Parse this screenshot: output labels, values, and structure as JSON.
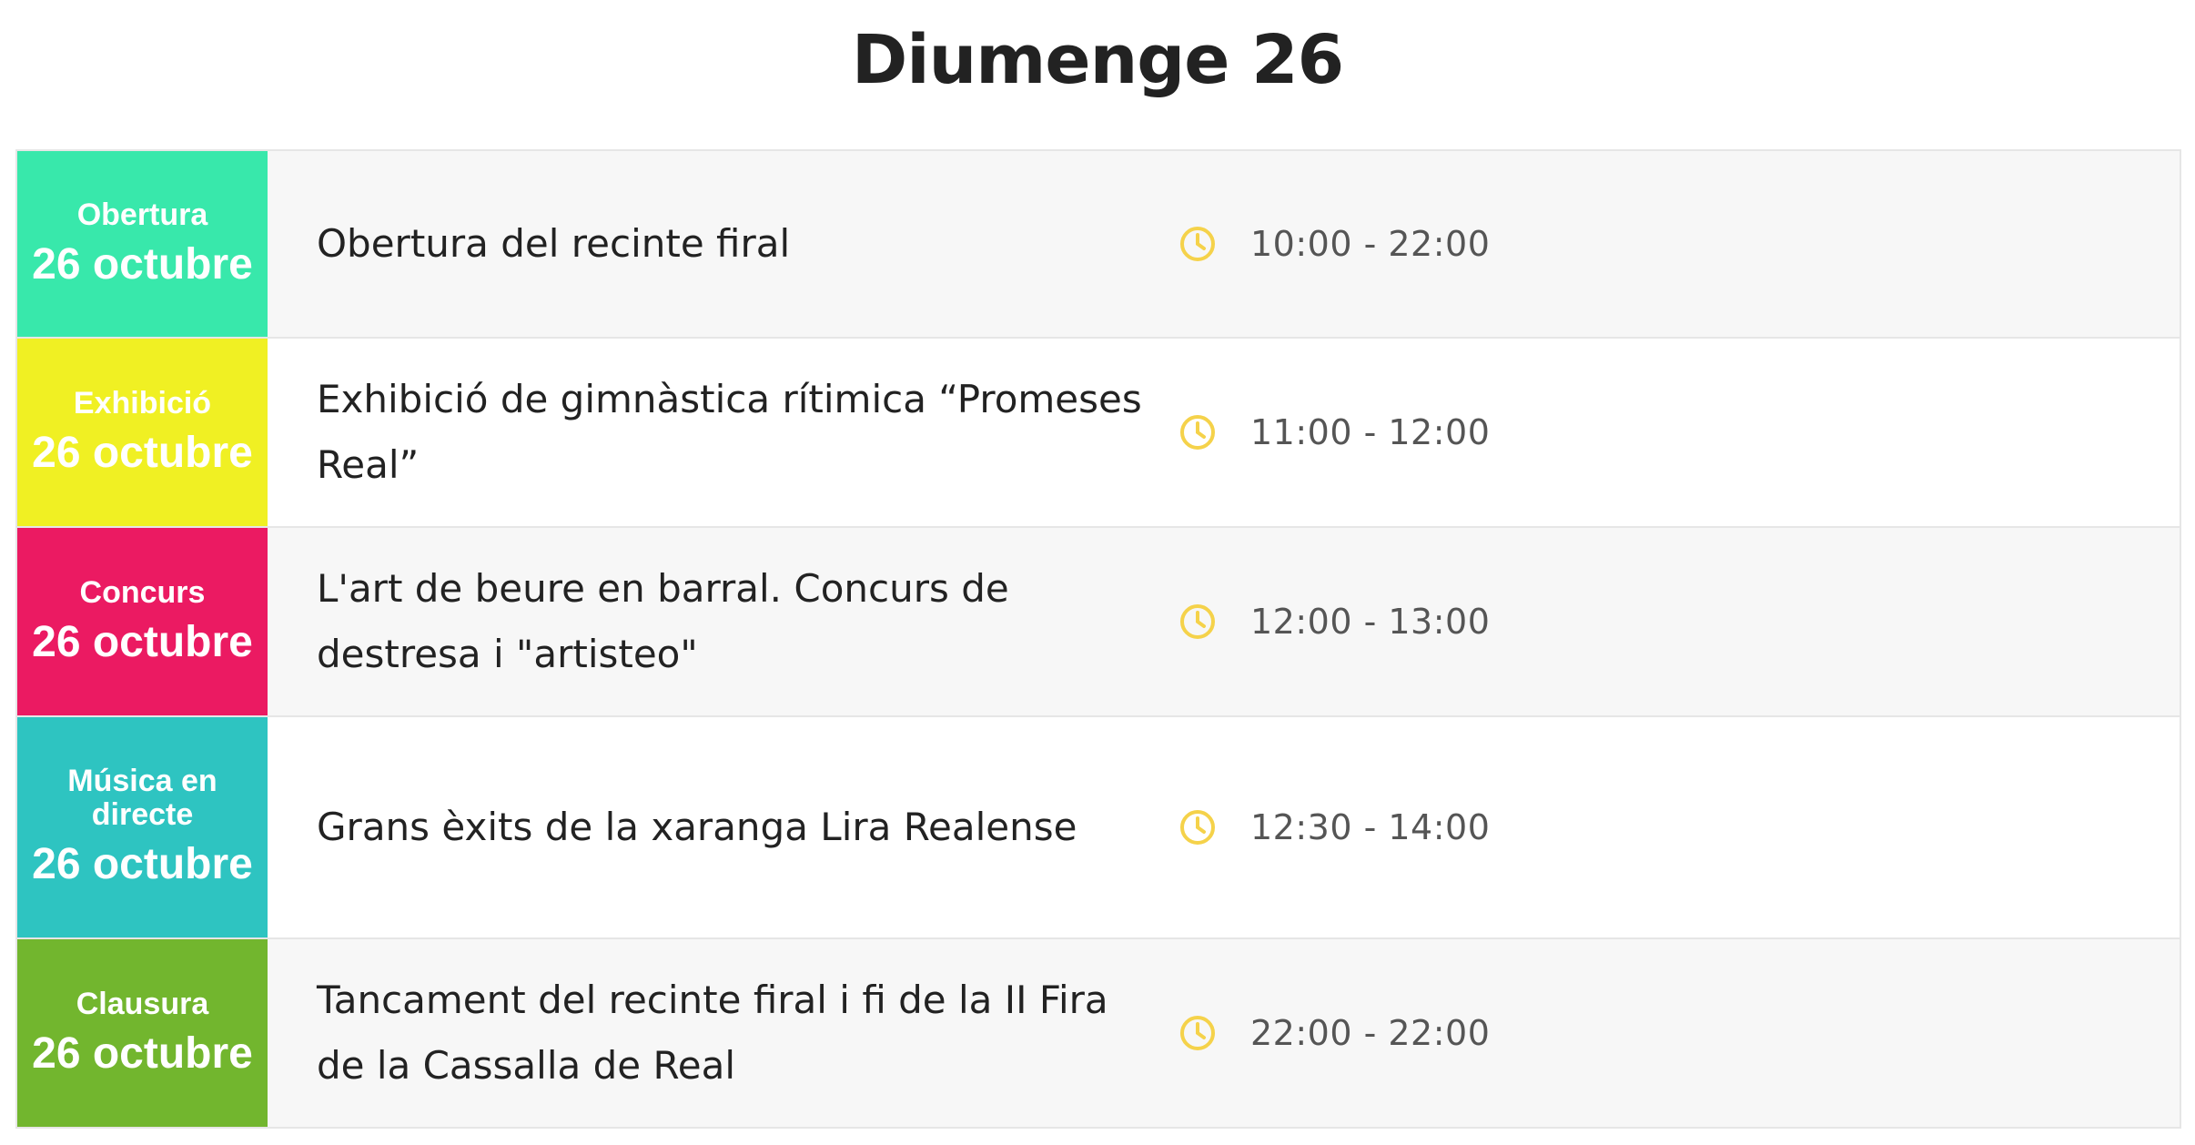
{
  "page": {
    "title": "Diumenge 26"
  },
  "colors": {
    "obertura": "#38e8ab",
    "exhibicio": "#f0f023",
    "concurs": "#eb1a62",
    "musica": "#2ec4c1",
    "clausura": "#72b62e",
    "clock": "#f5d24a"
  },
  "events": [
    {
      "category": "Obertura",
      "date": "26 octubre",
      "title": "Obertura del recinte firal",
      "time": "10:00 - 22:00",
      "icon": "clock-icon"
    },
    {
      "category": "Exhibició",
      "date": "26 octubre",
      "title": "Exhibició de gimnàstica rítimica “Promeses Real”",
      "time": "11:00 - 12:00",
      "icon": "clock-icon"
    },
    {
      "category": "Concurs",
      "date": "26 octubre",
      "title": "L'art de beure en barral. Concurs de destresa i \"artisteo\"",
      "time": "12:00 - 13:00",
      "icon": "clock-icon"
    },
    {
      "category": "Música en directe",
      "date": "26 octubre",
      "title": "Grans èxits de la xaranga Lira Realense",
      "time": "12:30 - 14:00",
      "icon": "clock-icon"
    },
    {
      "category": "Clausura",
      "date": "26 octubre",
      "title": "Tancament del recinte firal i fi de la II Fira de la Cassalla de Real",
      "time": "22:00 - 22:00",
      "icon": "clock-icon"
    }
  ]
}
